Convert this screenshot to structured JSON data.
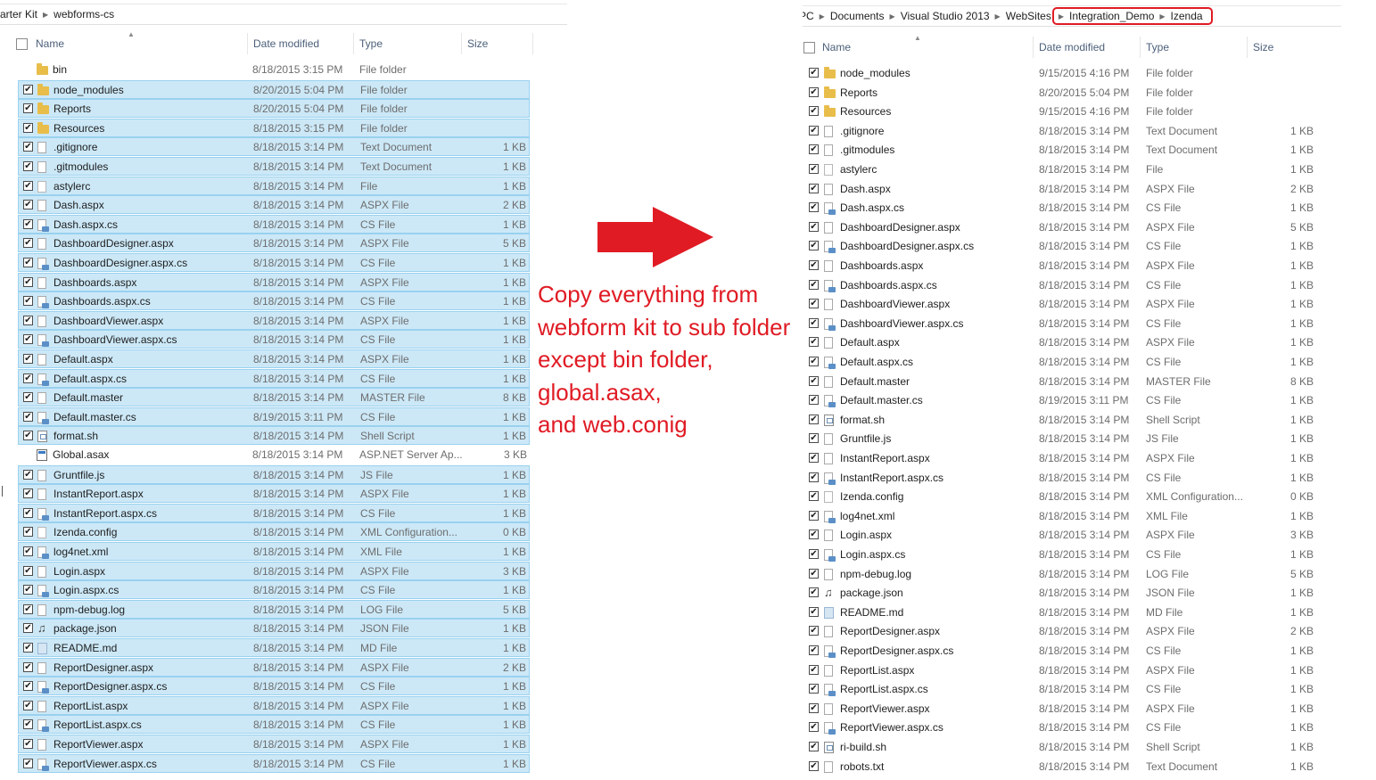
{
  "left_pane": {
    "breadcrumb": [
      "arter Kit",
      "webforms-cs"
    ],
    "columns": {
      "name": "Name",
      "date": "Date modified",
      "type": "Type",
      "size": "Size"
    },
    "rows": [
      {
        "name": "bin",
        "date": "8/18/2015 3:15 PM",
        "type": "File folder",
        "size": "",
        "icon": "folder-icon",
        "checked": false,
        "selected": false
      },
      {
        "name": "node_modules",
        "date": "8/20/2015 5:04 PM",
        "type": "File folder",
        "size": "",
        "icon": "folder-icon",
        "checked": true,
        "selected": true
      },
      {
        "name": "Reports",
        "date": "8/20/2015 5:04 PM",
        "type": "File folder",
        "size": "",
        "icon": "folder-icon",
        "checked": true,
        "selected": true
      },
      {
        "name": "Resources",
        "date": "8/18/2015 3:15 PM",
        "type": "File folder",
        "size": "",
        "icon": "folder-icon",
        "checked": true,
        "selected": true
      },
      {
        "name": ".gitignore",
        "date": "8/18/2015 3:14 PM",
        "type": "Text Document",
        "size": "1 KB",
        "icon": "text-file-icon",
        "checked": true,
        "selected": true
      },
      {
        "name": ".gitmodules",
        "date": "8/18/2015 3:14 PM",
        "type": "Text Document",
        "size": "1 KB",
        "icon": "text-file-icon",
        "checked": true,
        "selected": true
      },
      {
        "name": "astylerc",
        "date": "8/18/2015 3:14 PM",
        "type": "File",
        "size": "1 KB",
        "icon": "blank-file-icon",
        "checked": true,
        "selected": true
      },
      {
        "name": "Dash.aspx",
        "date": "8/18/2015 3:14 PM",
        "type": "ASPX File",
        "size": "2 KB",
        "icon": "aspx-file-icon",
        "checked": true,
        "selected": true
      },
      {
        "name": "Dash.aspx.cs",
        "date": "8/18/2015 3:14 PM",
        "type": "CS File",
        "size": "1 KB",
        "icon": "cs-file-icon",
        "checked": true,
        "selected": true
      },
      {
        "name": "DashboardDesigner.aspx",
        "date": "8/18/2015 3:14 PM",
        "type": "ASPX File",
        "size": "5 KB",
        "icon": "aspx-file-icon",
        "checked": true,
        "selected": true
      },
      {
        "name": "DashboardDesigner.aspx.cs",
        "date": "8/18/2015 3:14 PM",
        "type": "CS File",
        "size": "1 KB",
        "icon": "cs-file-icon",
        "checked": true,
        "selected": true
      },
      {
        "name": "Dashboards.aspx",
        "date": "8/18/2015 3:14 PM",
        "type": "ASPX File",
        "size": "1 KB",
        "icon": "aspx-file-icon",
        "checked": true,
        "selected": true
      },
      {
        "name": "Dashboards.aspx.cs",
        "date": "8/18/2015 3:14 PM",
        "type": "CS File",
        "size": "1 KB",
        "icon": "cs-file-icon",
        "checked": true,
        "selected": true
      },
      {
        "name": "DashboardViewer.aspx",
        "date": "8/18/2015 3:14 PM",
        "type": "ASPX File",
        "size": "1 KB",
        "icon": "aspx-file-icon",
        "checked": true,
        "selected": true
      },
      {
        "name": "DashboardViewer.aspx.cs",
        "date": "8/18/2015 3:14 PM",
        "type": "CS File",
        "size": "1 KB",
        "icon": "cs-file-icon",
        "checked": true,
        "selected": true
      },
      {
        "name": "Default.aspx",
        "date": "8/18/2015 3:14 PM",
        "type": "ASPX File",
        "size": "1 KB",
        "icon": "aspx-file-icon",
        "checked": true,
        "selected": true
      },
      {
        "name": "Default.aspx.cs",
        "date": "8/18/2015 3:14 PM",
        "type": "CS File",
        "size": "1 KB",
        "icon": "cs-file-icon",
        "checked": true,
        "selected": true
      },
      {
        "name": "Default.master",
        "date": "8/18/2015 3:14 PM",
        "type": "MASTER File",
        "size": "8 KB",
        "icon": "master-file-icon",
        "checked": true,
        "selected": true
      },
      {
        "name": "Default.master.cs",
        "date": "8/19/2015 3:11 PM",
        "type": "CS File",
        "size": "1 KB",
        "icon": "cs-file-icon",
        "checked": true,
        "selected": true
      },
      {
        "name": "format.sh",
        "date": "8/18/2015 3:14 PM",
        "type": "Shell Script",
        "size": "1 KB",
        "icon": "script-file-icon",
        "checked": true,
        "selected": true
      },
      {
        "name": "Global.asax",
        "date": "8/18/2015 3:14 PM",
        "type": "ASP.NET Server Ap...",
        "size": "3 KB",
        "icon": "asax-file-icon",
        "checked": false,
        "selected": false
      },
      {
        "name": "Gruntfile.js",
        "date": "8/18/2015 3:14 PM",
        "type": "JS File",
        "size": "1 KB",
        "icon": "js-file-icon",
        "checked": true,
        "selected": true
      },
      {
        "name": "InstantReport.aspx",
        "date": "8/18/2015 3:14 PM",
        "type": "ASPX File",
        "size": "1 KB",
        "icon": "aspx-file-icon",
        "checked": true,
        "selected": true
      },
      {
        "name": "InstantReport.aspx.cs",
        "date": "8/18/2015 3:14 PM",
        "type": "CS File",
        "size": "1 KB",
        "icon": "cs-file-icon",
        "checked": true,
        "selected": true
      },
      {
        "name": "Izenda.config",
        "date": "8/18/2015 3:14 PM",
        "type": "XML Configuration...",
        "size": "0 KB",
        "icon": "blank-file-icon",
        "checked": true,
        "selected": true
      },
      {
        "name": "log4net.xml",
        "date": "8/18/2015 3:14 PM",
        "type": "XML File",
        "size": "1 KB",
        "icon": "cs-file-icon",
        "checked": true,
        "selected": true
      },
      {
        "name": "Login.aspx",
        "date": "8/18/2015 3:14 PM",
        "type": "ASPX File",
        "size": "3 KB",
        "icon": "aspx-file-icon",
        "checked": true,
        "selected": true
      },
      {
        "name": "Login.aspx.cs",
        "date": "8/18/2015 3:14 PM",
        "type": "CS File",
        "size": "1 KB",
        "icon": "cs-file-icon",
        "checked": true,
        "selected": true
      },
      {
        "name": "npm-debug.log",
        "date": "8/18/2015 3:14 PM",
        "type": "LOG File",
        "size": "5 KB",
        "icon": "text-file-icon",
        "checked": true,
        "selected": true
      },
      {
        "name": "package.json",
        "date": "8/18/2015 3:14 PM",
        "type": "JSON File",
        "size": "1 KB",
        "icon": "json-file-icon",
        "checked": true,
        "selected": true
      },
      {
        "name": "README.md",
        "date": "8/18/2015 3:14 PM",
        "type": "MD File",
        "size": "1 KB",
        "icon": "md-file-icon",
        "checked": true,
        "selected": true
      },
      {
        "name": "ReportDesigner.aspx",
        "date": "8/18/2015 3:14 PM",
        "type": "ASPX File",
        "size": "2 KB",
        "icon": "aspx-file-icon",
        "checked": true,
        "selected": true
      },
      {
        "name": "ReportDesigner.aspx.cs",
        "date": "8/18/2015 3:14 PM",
        "type": "CS File",
        "size": "1 KB",
        "icon": "cs-file-icon",
        "checked": true,
        "selected": true
      },
      {
        "name": "ReportList.aspx",
        "date": "8/18/2015 3:14 PM",
        "type": "ASPX File",
        "size": "1 KB",
        "icon": "aspx-file-icon",
        "checked": true,
        "selected": true
      },
      {
        "name": "ReportList.aspx.cs",
        "date": "8/18/2015 3:14 PM",
        "type": "CS File",
        "size": "1 KB",
        "icon": "cs-file-icon",
        "checked": true,
        "selected": true
      },
      {
        "name": "ReportViewer.aspx",
        "date": "8/18/2015 3:14 PM",
        "type": "ASPX File",
        "size": "1 KB",
        "icon": "aspx-file-icon",
        "checked": true,
        "selected": true
      },
      {
        "name": "ReportViewer.aspx.cs",
        "date": "8/18/2015 3:14 PM",
        "type": "CS File",
        "size": "1 KB",
        "icon": "cs-file-icon",
        "checked": true,
        "selected": true
      }
    ]
  },
  "right_pane": {
    "breadcrumb": [
      "PC",
      "Documents",
      "Visual Studio 2013",
      "WebSites"
    ],
    "breadcrumb_highlighted": [
      "Integration_Demo",
      "Izenda"
    ],
    "columns": {
      "name": "Name",
      "date": "Date modified",
      "type": "Type",
      "size": "Size"
    },
    "rows": [
      {
        "name": "node_modules",
        "date": "9/15/2015 4:16 PM",
        "type": "File folder",
        "size": "",
        "icon": "folder-icon"
      },
      {
        "name": "Reports",
        "date": "8/20/2015 5:04 PM",
        "type": "File folder",
        "size": "",
        "icon": "folder-icon"
      },
      {
        "name": "Resources",
        "date": "9/15/2015 4:16 PM",
        "type": "File folder",
        "size": "",
        "icon": "folder-icon"
      },
      {
        "name": ".gitignore",
        "date": "8/18/2015 3:14 PM",
        "type": "Text Document",
        "size": "1 KB",
        "icon": "text-file-icon"
      },
      {
        "name": ".gitmodules",
        "date": "8/18/2015 3:14 PM",
        "type": "Text Document",
        "size": "1 KB",
        "icon": "text-file-icon"
      },
      {
        "name": "astylerc",
        "date": "8/18/2015 3:14 PM",
        "type": "File",
        "size": "1 KB",
        "icon": "blank-file-icon"
      },
      {
        "name": "Dash.aspx",
        "date": "8/18/2015 3:14 PM",
        "type": "ASPX File",
        "size": "2 KB",
        "icon": "aspx-file-icon"
      },
      {
        "name": "Dash.aspx.cs",
        "date": "8/18/2015 3:14 PM",
        "type": "CS File",
        "size": "1 KB",
        "icon": "cs-file-icon"
      },
      {
        "name": "DashboardDesigner.aspx",
        "date": "8/18/2015 3:14 PM",
        "type": "ASPX File",
        "size": "5 KB",
        "icon": "aspx-file-icon"
      },
      {
        "name": "DashboardDesigner.aspx.cs",
        "date": "8/18/2015 3:14 PM",
        "type": "CS File",
        "size": "1 KB",
        "icon": "cs-file-icon"
      },
      {
        "name": "Dashboards.aspx",
        "date": "8/18/2015 3:14 PM",
        "type": "ASPX File",
        "size": "1 KB",
        "icon": "aspx-file-icon"
      },
      {
        "name": "Dashboards.aspx.cs",
        "date": "8/18/2015 3:14 PM",
        "type": "CS File",
        "size": "1 KB",
        "icon": "cs-file-icon"
      },
      {
        "name": "DashboardViewer.aspx",
        "date": "8/18/2015 3:14 PM",
        "type": "ASPX File",
        "size": "1 KB",
        "icon": "aspx-file-icon"
      },
      {
        "name": "DashboardViewer.aspx.cs",
        "date": "8/18/2015 3:14 PM",
        "type": "CS File",
        "size": "1 KB",
        "icon": "cs-file-icon"
      },
      {
        "name": "Default.aspx",
        "date": "8/18/2015 3:14 PM",
        "type": "ASPX File",
        "size": "1 KB",
        "icon": "aspx-file-icon"
      },
      {
        "name": "Default.aspx.cs",
        "date": "8/18/2015 3:14 PM",
        "type": "CS File",
        "size": "1 KB",
        "icon": "cs-file-icon"
      },
      {
        "name": "Default.master",
        "date": "8/18/2015 3:14 PM",
        "type": "MASTER File",
        "size": "8 KB",
        "icon": "master-file-icon"
      },
      {
        "name": "Default.master.cs",
        "date": "8/19/2015 3:11 PM",
        "type": "CS File",
        "size": "1 KB",
        "icon": "cs-file-icon"
      },
      {
        "name": "format.sh",
        "date": "8/18/2015 3:14 PM",
        "type": "Shell Script",
        "size": "1 KB",
        "icon": "script-file-icon"
      },
      {
        "name": "Gruntfile.js",
        "date": "8/18/2015 3:14 PM",
        "type": "JS File",
        "size": "1 KB",
        "icon": "js-file-icon"
      },
      {
        "name": "InstantReport.aspx",
        "date": "8/18/2015 3:14 PM",
        "type": "ASPX File",
        "size": "1 KB",
        "icon": "aspx-file-icon"
      },
      {
        "name": "InstantReport.aspx.cs",
        "date": "8/18/2015 3:14 PM",
        "type": "CS File",
        "size": "1 KB",
        "icon": "cs-file-icon"
      },
      {
        "name": "Izenda.config",
        "date": "8/18/2015 3:14 PM",
        "type": "XML Configuration...",
        "size": "0 KB",
        "icon": "blank-file-icon"
      },
      {
        "name": "log4net.xml",
        "date": "8/18/2015 3:14 PM",
        "type": "XML File",
        "size": "1 KB",
        "icon": "cs-file-icon"
      },
      {
        "name": "Login.aspx",
        "date": "8/18/2015 3:14 PM",
        "type": "ASPX File",
        "size": "3 KB",
        "icon": "aspx-file-icon"
      },
      {
        "name": "Login.aspx.cs",
        "date": "8/18/2015 3:14 PM",
        "type": "CS File",
        "size": "1 KB",
        "icon": "cs-file-icon"
      },
      {
        "name": "npm-debug.log",
        "date": "8/18/2015 3:14 PM",
        "type": "LOG File",
        "size": "5 KB",
        "icon": "text-file-icon"
      },
      {
        "name": "package.json",
        "date": "8/18/2015 3:14 PM",
        "type": "JSON File",
        "size": "1 KB",
        "icon": "json-file-icon"
      },
      {
        "name": "README.md",
        "date": "8/18/2015 3:14 PM",
        "type": "MD File",
        "size": "1 KB",
        "icon": "md-file-icon"
      },
      {
        "name": "ReportDesigner.aspx",
        "date": "8/18/2015 3:14 PM",
        "type": "ASPX File",
        "size": "2 KB",
        "icon": "aspx-file-icon"
      },
      {
        "name": "ReportDesigner.aspx.cs",
        "date": "8/18/2015 3:14 PM",
        "type": "CS File",
        "size": "1 KB",
        "icon": "cs-file-icon"
      },
      {
        "name": "ReportList.aspx",
        "date": "8/18/2015 3:14 PM",
        "type": "ASPX File",
        "size": "1 KB",
        "icon": "aspx-file-icon"
      },
      {
        "name": "ReportList.aspx.cs",
        "date": "8/18/2015 3:14 PM",
        "type": "CS File",
        "size": "1 KB",
        "icon": "cs-file-icon"
      },
      {
        "name": "ReportViewer.aspx",
        "date": "8/18/2015 3:14 PM",
        "type": "ASPX File",
        "size": "1 KB",
        "icon": "aspx-file-icon"
      },
      {
        "name": "ReportViewer.aspx.cs",
        "date": "8/18/2015 3:14 PM",
        "type": "CS File",
        "size": "1 KB",
        "icon": "cs-file-icon"
      },
      {
        "name": "ri-build.sh",
        "date": "8/18/2015 3:14 PM",
        "type": "Shell Script",
        "size": "1 KB",
        "icon": "script-file-icon"
      },
      {
        "name": "robots.txt",
        "date": "8/18/2015 3:14 PM",
        "type": "Text Document",
        "size": "1 KB",
        "icon": "text-file-icon"
      }
    ]
  },
  "annotation": {
    "lines": [
      "Copy everything from",
      "webform kit to sub folder",
      "except bin folder,",
      "global.asax,",
      "and web.conig"
    ]
  },
  "colors": {
    "annotation_red": "#e01b24",
    "selection_fill": "#cce8f7",
    "selection_border": "#99d1ef",
    "folder": "#e8bd4a",
    "header_text": "#4c607a"
  }
}
